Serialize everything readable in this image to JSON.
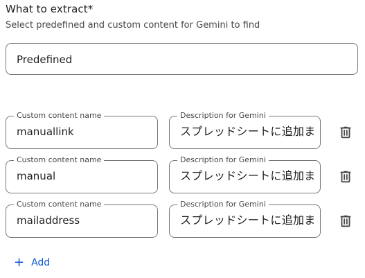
{
  "section": {
    "title": "What to extract*",
    "subtitle": "Select predefined and custom content for Gemini to find"
  },
  "select": {
    "value": "Predefined"
  },
  "custom_fields": [
    {
      "name_label": "Custom content name",
      "name_value": "manuallink",
      "desc_label": "Description for Gemini",
      "desc_value": "スプレッドシートに追加ま"
    },
    {
      "name_label": "Custom content name",
      "name_value": "manual",
      "desc_label": "Description for Gemini",
      "desc_value": "スプレッドシートに追加ま"
    },
    {
      "name_label": "Custom content name",
      "name_value": "mailaddress",
      "desc_label": "Description for Gemini",
      "desc_value": "スプレッドシートに追加ま"
    }
  ],
  "add_button": {
    "icon": "plus-icon",
    "label": "Add"
  },
  "colors": {
    "accent": "#0b57d0",
    "border": "#747775",
    "label": "#444746"
  }
}
